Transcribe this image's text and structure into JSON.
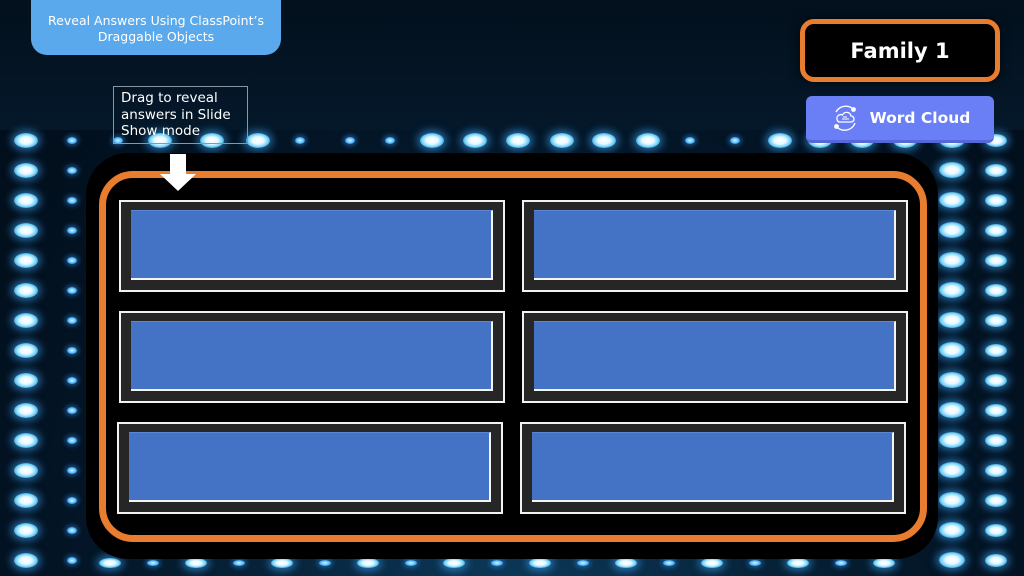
{
  "slide": {
    "title_banner": {
      "line1": "Reveal Answers Using ClassPoint’s",
      "line2": "Draggable Objects"
    },
    "hint": {
      "text": "Drag to reveal answers in Slide Show mode"
    },
    "family_label": "Family 1",
    "word_cloud_button": {
      "label": "Word Cloud",
      "icon": "cloud-cycle-icon"
    },
    "answer_slots": [
      {
        "id": 1,
        "text": "",
        "state": "hidden"
      },
      {
        "id": 2,
        "text": "",
        "state": "hidden"
      },
      {
        "id": 3,
        "text": "",
        "state": "hidden"
      },
      {
        "id": 4,
        "text": "",
        "state": "hidden"
      },
      {
        "id": 5,
        "text": "",
        "state": "hidden"
      },
      {
        "id": 6,
        "text": "",
        "state": "hidden"
      }
    ],
    "colors": {
      "board_border": "#e87d2f",
      "answer_cover": "#4472c4",
      "button": "#6a7ef5",
      "banner": "#5aa9ec"
    }
  }
}
